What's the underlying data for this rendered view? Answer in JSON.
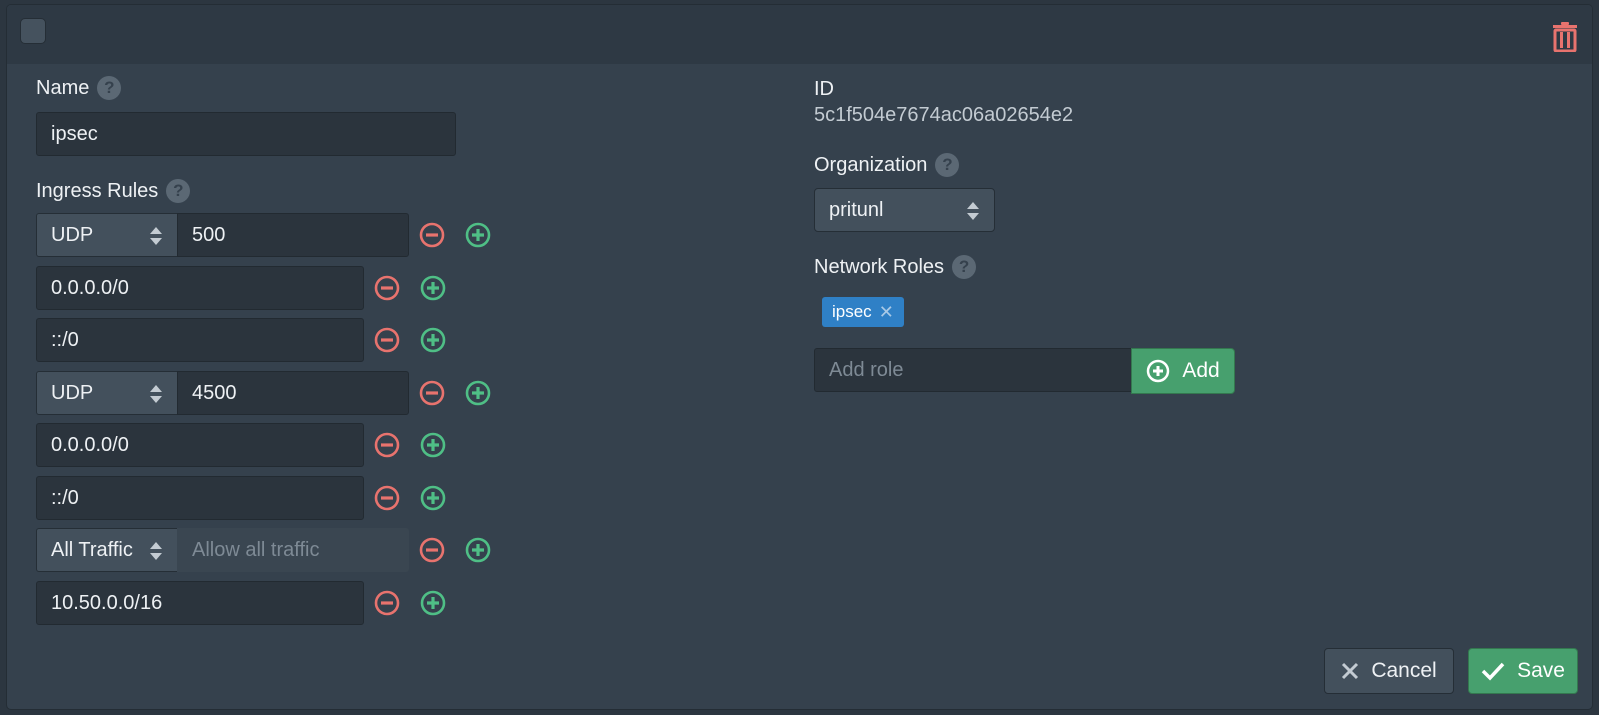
{
  "header": {
    "select_checkbox": false,
    "delete_icon": "trash-icon"
  },
  "left": {
    "name_label": "Name",
    "name_value": "ipsec",
    "ingress_label": "Ingress Rules",
    "rules": [
      {
        "type": "select",
        "protocol": "UDP",
        "port": "500"
      },
      {
        "type": "cidr",
        "value": "0.0.0.0/0"
      },
      {
        "type": "cidr",
        "value": "::/0"
      },
      {
        "type": "select",
        "protocol": "UDP",
        "port": "4500"
      },
      {
        "type": "cidr",
        "value": "0.0.0.0/0"
      },
      {
        "type": "cidr",
        "value": "::/0"
      },
      {
        "type": "select",
        "protocol": "All Traffic",
        "port_placeholder": "Allow all traffic"
      },
      {
        "type": "cidr",
        "value": "10.50.0.0/16"
      }
    ]
  },
  "right": {
    "id_label": "ID",
    "id_value": "5c1f504e7674ac06a02654e2",
    "org_label": "Organization",
    "org_value": "pritunl",
    "roles_label": "Network Roles",
    "roles": [
      "ipsec"
    ],
    "add_role_placeholder": "Add role",
    "add_button": "Add"
  },
  "footer": {
    "cancel": "Cancel",
    "save": "Save"
  },
  "colors": {
    "accent_green": "#47a06e",
    "remove_red": "#e8736e",
    "add_green": "#4fbf86",
    "tag_blue": "#2f80c6",
    "trash_red": "#e8736e"
  }
}
